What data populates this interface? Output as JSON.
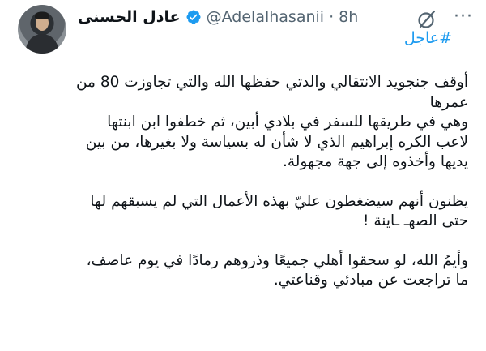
{
  "author": {
    "display_name": "عادل الحسنى",
    "handle": "@Adelalhasanii",
    "separator": "·",
    "time": "8h",
    "verified": true,
    "verified_color": "#1d9bf0"
  },
  "icons": {
    "avatar": "avatar",
    "verified": "verified-badge-icon",
    "grok": "grok-icon",
    "more": "more-options-icon"
  },
  "more_label": "···",
  "tweet": {
    "hashtag": "#عاجل",
    "hashtag_color": "#1d9bf0",
    "paragraphs": [
      "أوقف جنجويد الانتقالي والدتي حفظها الله والتي تجاوزت 80 من عمرها",
      "وهي في طريقها للسفر في بلادي أبين، ثم خطفوا ابن ابنتها لاعب الكره إبراهيم الذي لا شأن له بسياسة ولا بغيرها، من بين يديها وأخذوه إلى جهة مجهولة.",
      "يظنون أنهم سيضغطون عليّ بهذه الأعمال التي لم يسبقهم  لها حتى الصهـ ـاينة !",
      "وأيمُ الله، لو سحقوا أهلي جميعًا وذروهم رمادًا في يوم عاصف، ما تراجعت عن مبادئي وقناعتي."
    ]
  }
}
